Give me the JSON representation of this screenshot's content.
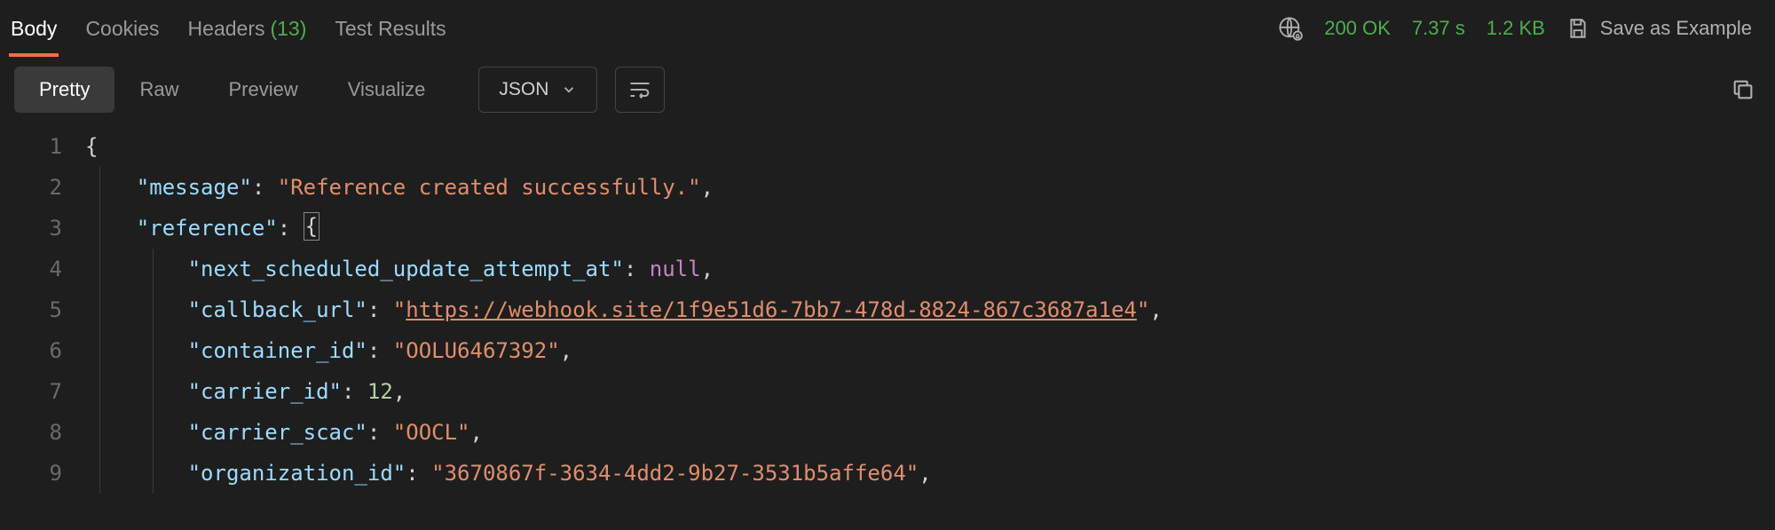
{
  "tabs": {
    "body": "Body",
    "cookies": "Cookies",
    "headers": "Headers",
    "headers_count": "(13)",
    "test_results": "Test Results"
  },
  "status": {
    "code": "200 OK",
    "time": "7.37 s",
    "size": "1.2 KB",
    "save_example": "Save as Example"
  },
  "view_tabs": {
    "pretty": "Pretty",
    "raw": "Raw",
    "preview": "Preview",
    "visualize": "Visualize"
  },
  "format_selector": "JSON",
  "line_numbers": [
    "1",
    "2",
    "3",
    "4",
    "5",
    "6",
    "7",
    "8",
    "9"
  ],
  "json_body": {
    "message_key": "\"message\"",
    "message_val": "\"Reference created successfully.\"",
    "reference_key": "\"reference\"",
    "next_key": "\"next_scheduled_update_attempt_at\"",
    "next_val": "null",
    "callback_key": "\"callback_url\"",
    "callback_val_q1": "\"",
    "callback_link": "https://webhook.site/1f9e51d6-7bb7-478d-8824-867c3687a1e4",
    "callback_val_q2": "\"",
    "container_key": "\"container_id\"",
    "container_val": "\"OOLU6467392\"",
    "carrier_id_key": "\"carrier_id\"",
    "carrier_id_val": "12",
    "carrier_scac_key": "\"carrier_scac\"",
    "carrier_scac_val": "\"OOCL\"",
    "org_key": "\"organization_id\"",
    "org_val": "\"3670867f-3634-4dd2-9b27-3531b5affe64\"",
    "brace_open": "{",
    "brace_open_boxed": "{",
    "colon": ":",
    "comma": ","
  }
}
